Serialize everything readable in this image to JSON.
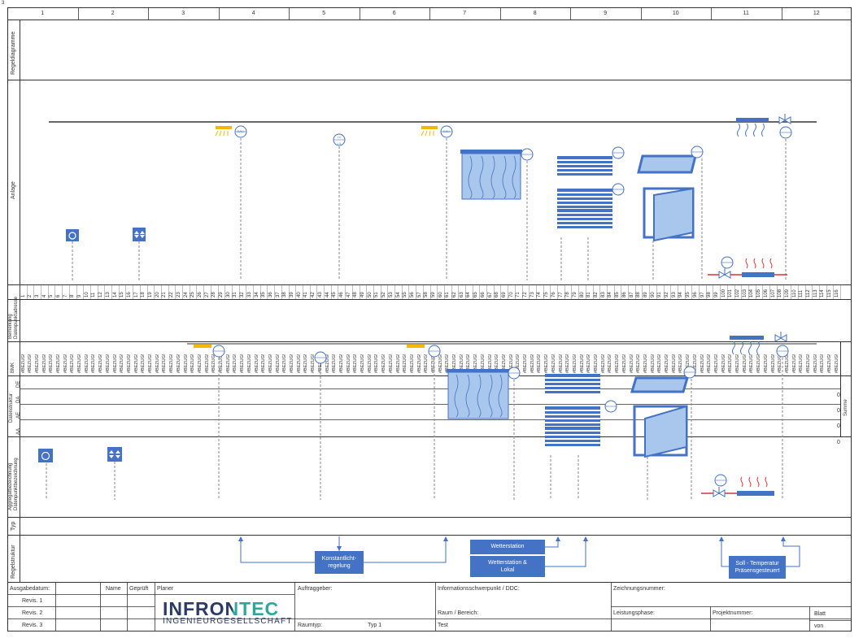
{
  "page_marker": "3",
  "columns": [
    "1",
    "2",
    "3",
    "4",
    "5",
    "6",
    "7",
    "8",
    "9",
    "10",
    "11",
    "12"
  ],
  "row_labels": {
    "regeldiagramme": "Regeldiagramme",
    "anlage": "Anlage",
    "bemerkung": "Bemerkung",
    "datenpunktadresse": "Datenpunktadresse",
    "bmk": "BMK",
    "de": "DE",
    "da": "DA",
    "ae": "AE",
    "aa": "AA",
    "datenstruktur": "Datenstruktur",
    "aggregatbezeichnung": "Aggregatbezeichnung",
    "datenpunktbezeichnung": "Datenpunktbezeichnung",
    "typ": "Typ",
    "regelstruktur": "Regelstruktur",
    "summe": "Summe"
  },
  "datapoint_numbers": [
    "1",
    "2",
    "3",
    "4",
    "5",
    "6",
    "7",
    "8",
    "9",
    "10",
    "11",
    "12",
    "13",
    "14",
    "15",
    "16",
    "17",
    "18",
    "19",
    "20",
    "21",
    "22",
    "23",
    "24",
    "25",
    "26",
    "27",
    "28",
    "29",
    "30",
    "31",
    "32",
    "33",
    "34",
    "35",
    "36",
    "37",
    "38",
    "39",
    "40",
    "41",
    "42",
    "43",
    "44",
    "45",
    "46",
    "47",
    "48",
    "49",
    "50",
    "51",
    "52",
    "53",
    "54",
    "55",
    "56",
    "57",
    "58",
    "59",
    "60",
    "61",
    "62",
    "63",
    "64",
    "65",
    "66",
    "67",
    "68",
    "69",
    "70",
    "71",
    "72",
    "73",
    "74",
    "75",
    "76",
    "77",
    "78",
    "79",
    "80",
    "81",
    "82",
    "83",
    "84",
    "85",
    "86",
    "87",
    "88",
    "89",
    "90",
    "91",
    "92",
    "93",
    "94",
    "95",
    "96",
    "97",
    "98",
    "99",
    "100",
    "101",
    "102",
    "103",
    "104",
    "105",
    "106",
    "107",
    "108",
    "109",
    "110",
    "111",
    "112",
    "113",
    "114",
    "115",
    "116"
  ],
  "bmk_value": "#BEZUG!",
  "sum_values": [
    "0",
    "0",
    "0",
    "0"
  ],
  "sensor_labels": {
    "dali": "DALI",
    "lc": "LC",
    "lx": "LX",
    "sm": "SM"
  },
  "regelstruktur": {
    "konstantlicht": "Konstantlicht-\nregelung",
    "wetterstation": "Wetterstation",
    "wetterstation_lokal": "Wetterstation &\nLokal",
    "soll_temperatur": "Soll - Temperatur\nPräsensgesteuert"
  },
  "title_block": {
    "ausgabedatum": "Ausgabedatum:",
    "name": "Name",
    "geprueft": "Geprüft",
    "planer": "Planer",
    "revis1": "Revis. 1",
    "revis2": "Revis. 2",
    "revis3": "Revis. 3",
    "logo_text": "INFRONTEC",
    "logo_sub": "INGENIEURGESELLSCHAFT",
    "auftraggeber": "Auftraggeber:",
    "raumtyp": "Raumtyp:",
    "raumtyp_value": "Typ 1",
    "informationsschwerpunkt": "Informationsschwerpunkt / DDC:",
    "raum_bereich": "Raum / Bereich:",
    "raum_bereich_value": "Test",
    "zeichnungsnummer": "Zeichnungsnummer:",
    "leistungsphase": "Leistungsphase:",
    "projektnummer": "Projektnummer:",
    "blatt": "Blatt",
    "von": "von"
  },
  "colors": {
    "accent": "#4472C4",
    "light_blue": "#A9C6EC",
    "lamp": "#F5B800",
    "heater": "#E03030"
  }
}
